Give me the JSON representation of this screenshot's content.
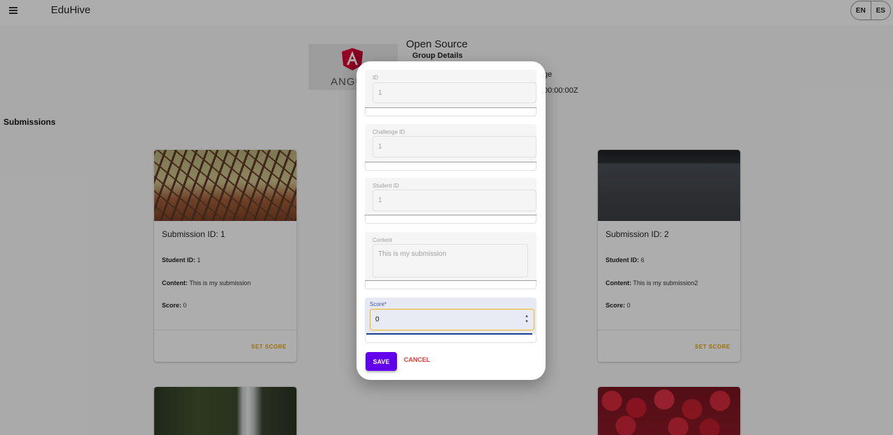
{
  "app": {
    "title": "EduHive"
  },
  "language": {
    "options": [
      "EN",
      "ES"
    ]
  },
  "group": {
    "logo_text": "ANGU",
    "name": "Open Source",
    "details_heading": "Group Details",
    "challenge_fragment": "ge",
    "date_fragment": "00:00:00Z"
  },
  "submissions_heading": "Submissions",
  "cards": [
    {
      "title": "Submission ID: 1",
      "student_label": "Student ID:",
      "student_id": "1",
      "content_label": "Content:",
      "content": "This is my submission",
      "score_label": "Score:",
      "score": "0",
      "action": "SET SCORE",
      "image": "bridge-photo"
    },
    {
      "title": "Submission ID: 2",
      "student_label": "Student ID:",
      "student_id": "6",
      "content_label": "Content:",
      "content": "This is my submission2",
      "score_label": "Score:",
      "score": "0",
      "action": "SET SCORE",
      "image": "desk-photo"
    },
    {
      "image": "waterfall-photo"
    },
    {
      "image": "strawberries-photo"
    }
  ],
  "dialog": {
    "fields": {
      "id": {
        "label": "ID",
        "value": "1"
      },
      "challenge_id": {
        "label": "Challenge ID",
        "value": "1"
      },
      "student_id": {
        "label": "Student ID",
        "value": "1"
      },
      "content": {
        "label": "Content",
        "value": "This is my submission"
      },
      "score": {
        "label": "Score*",
        "value": "0"
      }
    },
    "save_label": "SAVE",
    "cancel_label": "CANCEL"
  },
  "colors": {
    "primary": "#6200ee",
    "cancel": "#e53935",
    "action": "#e9a20f",
    "focus_border": "#f2b417"
  }
}
